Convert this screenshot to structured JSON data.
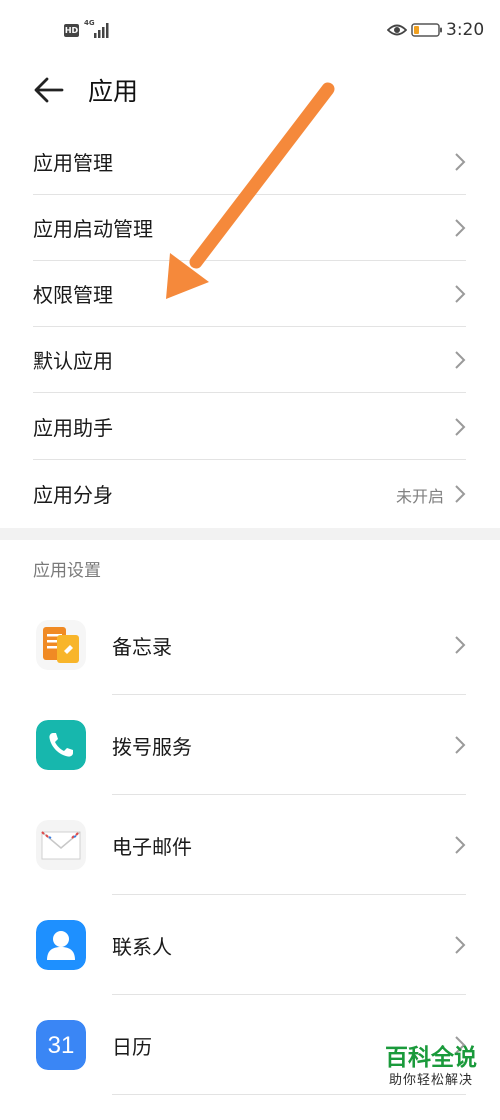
{
  "status_bar": {
    "hd_badge": "HD",
    "network_type": "4G",
    "time": "3:20",
    "battery_color": "#f0a020"
  },
  "header": {
    "title": "应用",
    "back_icon": "arrow-left-icon"
  },
  "menu": {
    "items": [
      {
        "label": "应用管理"
      },
      {
        "label": "应用启动管理"
      },
      {
        "label": "权限管理"
      },
      {
        "label": "默认应用"
      },
      {
        "label": "应用助手"
      },
      {
        "label": "应用分身",
        "value": "未开启"
      }
    ]
  },
  "app_settings": {
    "header": "应用设置",
    "apps": [
      {
        "label": "备忘录",
        "icon": "notepad-icon"
      },
      {
        "label": "拨号服务",
        "icon": "phone-icon"
      },
      {
        "label": "电子邮件",
        "icon": "envelope-icon"
      },
      {
        "label": "联系人",
        "icon": "contact-icon"
      },
      {
        "label": "日历",
        "icon": "calendar-icon",
        "icon_text": "31"
      }
    ]
  },
  "annotation": {
    "arrow_color": "#f5893b"
  },
  "watermark": {
    "title": "百科全说",
    "subtitle": "助你轻松解决"
  }
}
